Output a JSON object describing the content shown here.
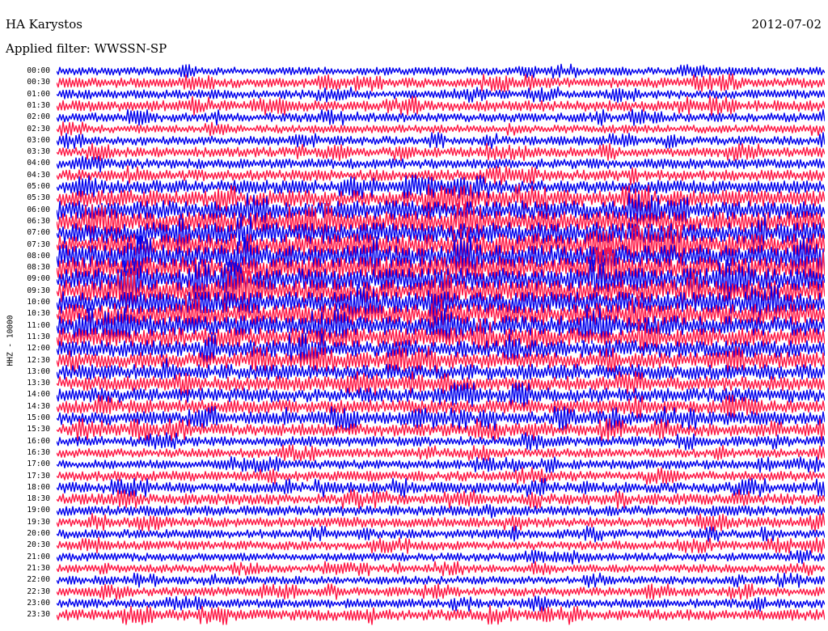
{
  "header": {
    "station": "HA Karystos",
    "date": "2012-07-02",
    "filter": "Applied filter: WWSSN-SP"
  },
  "chart_data": {
    "type": "line",
    "title": "HA Karystos",
    "date": "2012-07-02",
    "subtitle": "Applied filter: WWSSN-SP",
    "ylabel": "HHZ - 10000",
    "trace_colors": [
      "#0000ee",
      "#ff1744"
    ],
    "rows": [
      {
        "time": "00:00",
        "amplitude": 0.45
      },
      {
        "time": "00:30",
        "amplitude": 0.55
      },
      {
        "time": "01:00",
        "amplitude": 0.5
      },
      {
        "time": "01:30",
        "amplitude": 0.6
      },
      {
        "time": "02:00",
        "amplitude": 0.5
      },
      {
        "time": "02:30",
        "amplitude": 0.45
      },
      {
        "time": "03:00",
        "amplitude": 0.5
      },
      {
        "time": "03:30",
        "amplitude": 0.55
      },
      {
        "time": "04:00",
        "amplitude": 0.55
      },
      {
        "time": "04:30",
        "amplitude": 0.6
      },
      {
        "time": "05:00",
        "amplitude": 0.75
      },
      {
        "time": "05:30",
        "amplitude": 0.9
      },
      {
        "time": "06:00",
        "amplitude": 1.05
      },
      {
        "time": "06:30",
        "amplitude": 1.15
      },
      {
        "time": "07:00",
        "amplitude": 1.2
      },
      {
        "time": "07:30",
        "amplitude": 1.25
      },
      {
        "time": "08:00",
        "amplitude": 1.3
      },
      {
        "time": "08:30",
        "amplitude": 1.3
      },
      {
        "time": "09:00",
        "amplitude": 1.25
      },
      {
        "time": "09:30",
        "amplitude": 1.25
      },
      {
        "time": "10:00",
        "amplitude": 1.2
      },
      {
        "time": "10:30",
        "amplitude": 1.2
      },
      {
        "time": "11:00",
        "amplitude": 1.1
      },
      {
        "time": "11:30",
        "amplitude": 1.05
      },
      {
        "time": "12:00",
        "amplitude": 0.95
      },
      {
        "time": "12:30",
        "amplitude": 0.9
      },
      {
        "time": "13:00",
        "amplitude": 0.85
      },
      {
        "time": "13:30",
        "amplitude": 0.8
      },
      {
        "time": "14:00",
        "amplitude": 0.8
      },
      {
        "time": "14:30",
        "amplitude": 0.75
      },
      {
        "time": "15:00",
        "amplitude": 0.75
      },
      {
        "time": "15:30",
        "amplitude": 0.7
      },
      {
        "time": "16:00",
        "amplitude": 0.55
      },
      {
        "time": "16:30",
        "amplitude": 0.5
      },
      {
        "time": "17:00",
        "amplitude": 0.5
      },
      {
        "time": "17:30",
        "amplitude": 0.55
      },
      {
        "time": "18:00",
        "amplitude": 0.6
      },
      {
        "time": "18:30",
        "amplitude": 0.6
      },
      {
        "time": "19:00",
        "amplitude": 0.55
      },
      {
        "time": "19:30",
        "amplitude": 0.55
      },
      {
        "time": "20:00",
        "amplitude": 0.5
      },
      {
        "time": "20:30",
        "amplitude": 0.5
      },
      {
        "time": "21:00",
        "amplitude": 0.45
      },
      {
        "time": "21:30",
        "amplitude": 0.45
      },
      {
        "time": "22:00",
        "amplitude": 0.45
      },
      {
        "time": "22:30",
        "amplitude": 0.5
      },
      {
        "time": "23:00",
        "amplitude": 0.5
      },
      {
        "time": "23:30",
        "amplitude": 0.6
      }
    ]
  }
}
